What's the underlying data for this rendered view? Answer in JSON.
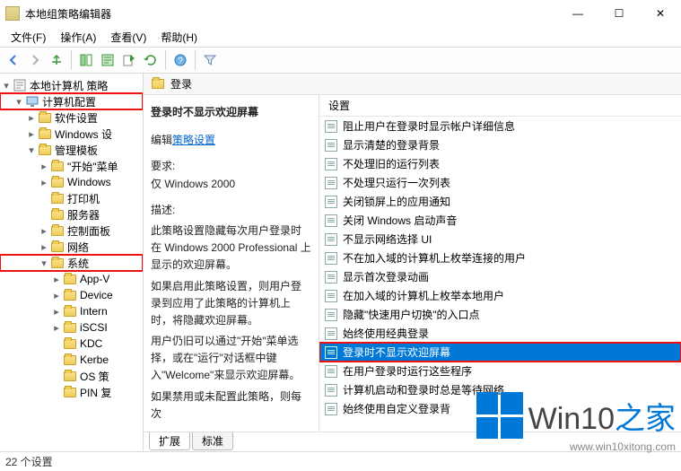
{
  "window": {
    "title": "本地组策略编辑器",
    "btn_min": "—",
    "btn_max": "☐",
    "btn_close": "✕"
  },
  "menu": {
    "file": "文件(F)",
    "action": "操作(A)",
    "view": "查看(V)",
    "help": "帮助(H)"
  },
  "tree": {
    "root": "本地计算机 策略",
    "computer_config": "计算机配置",
    "software": "软件设置",
    "windows_settings": "Windows 设",
    "admin_templates": "管理模板",
    "start_menu": "\"开始\"菜单",
    "windows": "Windows",
    "printers": "打印机",
    "servers": "服务器",
    "control_panel": "控制面板",
    "network": "网络",
    "system": "系统",
    "app_v": "App-V",
    "device": "Device",
    "intern": "Intern",
    "iscsi": "iSCSI",
    "kdc": "KDC",
    "kerbe": "Kerbe",
    "os_policy": "OS 策",
    "pin_recovery": "PIN 复"
  },
  "right_header": "登录",
  "desc": {
    "title": "登录时不显示欢迎屏幕",
    "edit_lbl": "编辑",
    "edit_link": "策略设置",
    "req_lbl": "要求:",
    "req_val": "仅 Windows 2000",
    "desc_lbl": "描述:",
    "p1": "此策略设置隐藏每次用户登录时在 Windows 2000 Professional 上显示的欢迎屏幕。",
    "p2": "如果启用此策略设置，则用户登录到应用了此策略的计算机上时，将隐藏欢迎屏幕。",
    "p3": "用户仍旧可以通过\"开始\"菜单选择，或在\"运行\"对话框中键入\"Welcome\"来显示欢迎屏幕。",
    "p4": "如果禁用或未配置此策略，则每次"
  },
  "settings": {
    "header": "设置",
    "items": [
      "阻止用户在登录时显示帐户详细信息",
      "显示清楚的登录背景",
      "不处理旧的运行列表",
      "不处理只运行一次列表",
      "关闭锁屏上的应用通知",
      "关闭 Windows 启动声音",
      "不显示网络选择 UI",
      "不在加入域的计算机上枚举连接的用户",
      "显示首次登录动画",
      "在加入域的计算机上枚举本地用户",
      "隐藏\"快速用户切换\"的入口点",
      "始终使用经典登录",
      "登录时不显示欢迎屏幕",
      "在用户登录时运行这些程序",
      "计算机启动和登录时总是等待网络",
      "始终使用自定义登录背"
    ],
    "selected_index": 12
  },
  "tabs": {
    "extended": "扩展",
    "standard": "标准"
  },
  "status": "22 个设置",
  "watermark": {
    "text_a": "Win10",
    "text_b": "之家",
    "url": "www.win10xitong.com"
  }
}
